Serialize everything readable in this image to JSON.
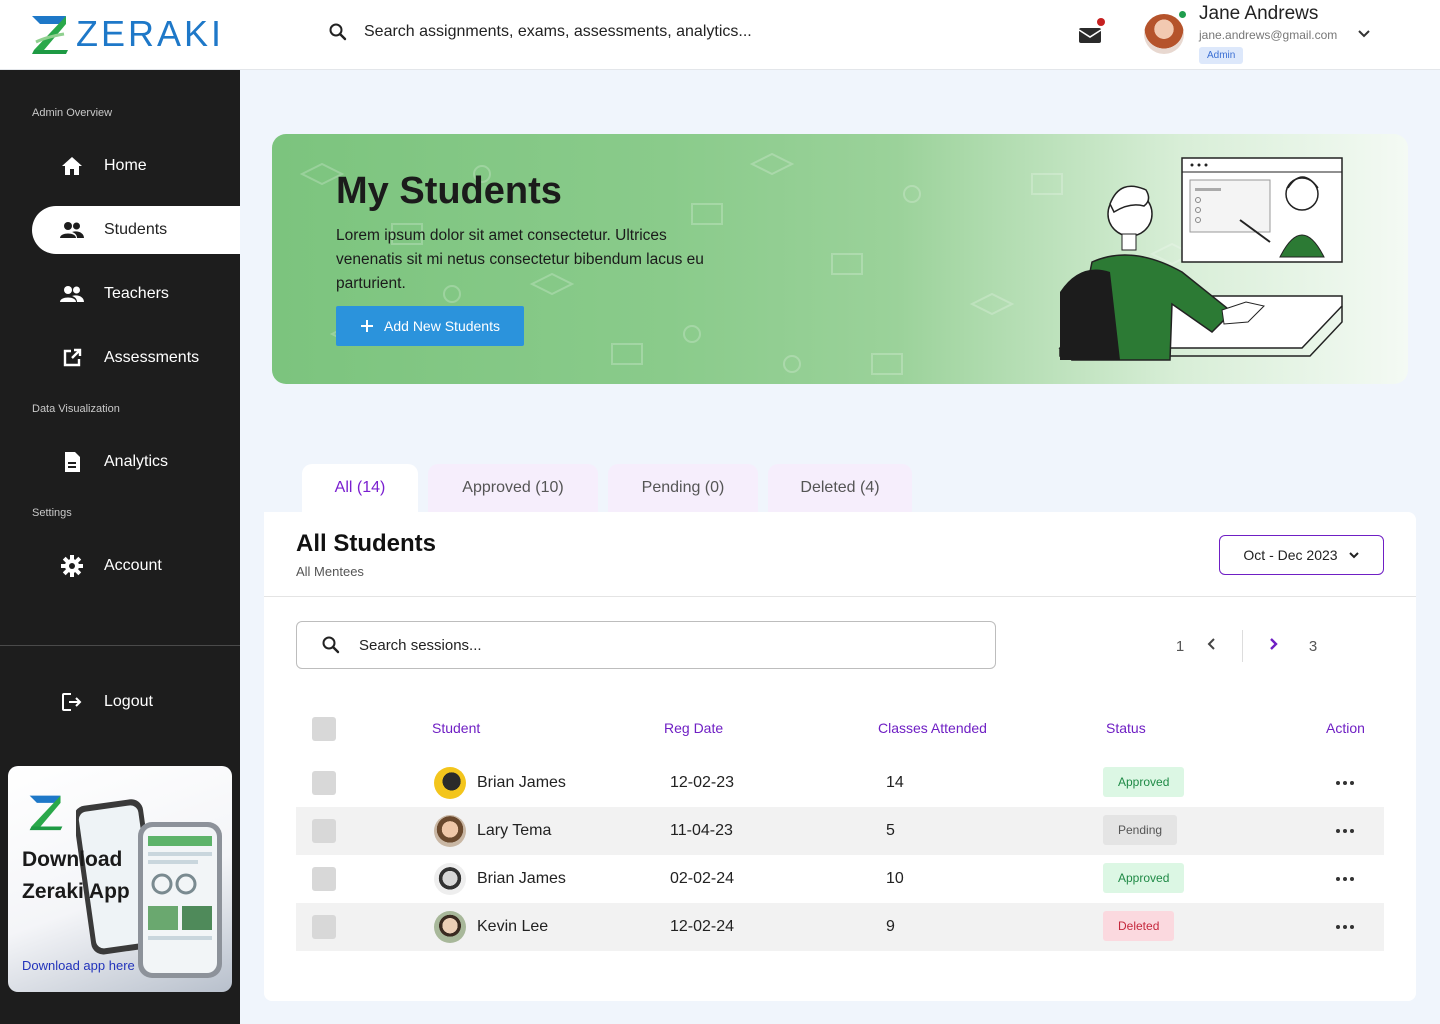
{
  "brand": {
    "name": "ZERAKI",
    "color": "#1e78c8"
  },
  "topbar": {
    "search_placeholder": "Search assignments, exams, assessments, analytics...",
    "user": {
      "name": "Jane Andrews",
      "email": "jane.andrews@gmail.com",
      "role": "Admin"
    }
  },
  "sidebar": {
    "sections": {
      "overview": "Admin Overview",
      "dataviz": "Data Visualization",
      "settings": "Settings"
    },
    "items": [
      {
        "label": "Home",
        "icon": "home-icon"
      },
      {
        "label": "Students",
        "icon": "users-icon",
        "active": true
      },
      {
        "label": "Teachers",
        "icon": "users-icon"
      },
      {
        "label": "Assessments",
        "icon": "external-link-icon"
      },
      {
        "label": "Analytics",
        "icon": "document-icon"
      },
      {
        "label": "Account",
        "icon": "gear-icon"
      },
      {
        "label": "Logout",
        "icon": "logout-icon"
      }
    ],
    "download": {
      "title_line1": "Download",
      "title_line2": "Zeraki App",
      "link": "Download app here"
    }
  },
  "banner": {
    "title": "My Students",
    "description": "Lorem ipsum dolor sit amet consectetur. Ultrices venenatis sit mi netus consectetur bibendum lacus eu parturient.",
    "button": "Add New Students"
  },
  "tabs": [
    {
      "label": "All (14)",
      "active": true
    },
    {
      "label": "Approved  (10)"
    },
    {
      "label": "Pending (0)"
    },
    {
      "label": "Deleted (4)"
    }
  ],
  "card": {
    "title": "All Students",
    "subtitle": "All Mentees",
    "date_range": "Oct - Dec 2023",
    "search_placeholder": "Search sessions...",
    "pager": {
      "first": "1",
      "last": "3"
    },
    "columns": [
      "Student",
      "Reg Date",
      "Classes Attended",
      "Status",
      "Action"
    ],
    "rows": [
      {
        "name": "Brian James",
        "reg_date": "12-02-23",
        "classes": "14",
        "status": "Approved"
      },
      {
        "name": "Lary Tema",
        "reg_date": "11-04-23",
        "classes": "5",
        "status": "Pending"
      },
      {
        "name": "Brian James",
        "reg_date": "02-02-24",
        "classes": "10",
        "status": "Approved"
      },
      {
        "name": "Kevin Lee",
        "reg_date": "12-02-24",
        "classes": "9",
        "status": "Deleted"
      }
    ]
  },
  "colors": {
    "accent": "#6f1fc4",
    "primary_button": "#2b93dc",
    "sidebar_bg": "#1d1d1d"
  }
}
